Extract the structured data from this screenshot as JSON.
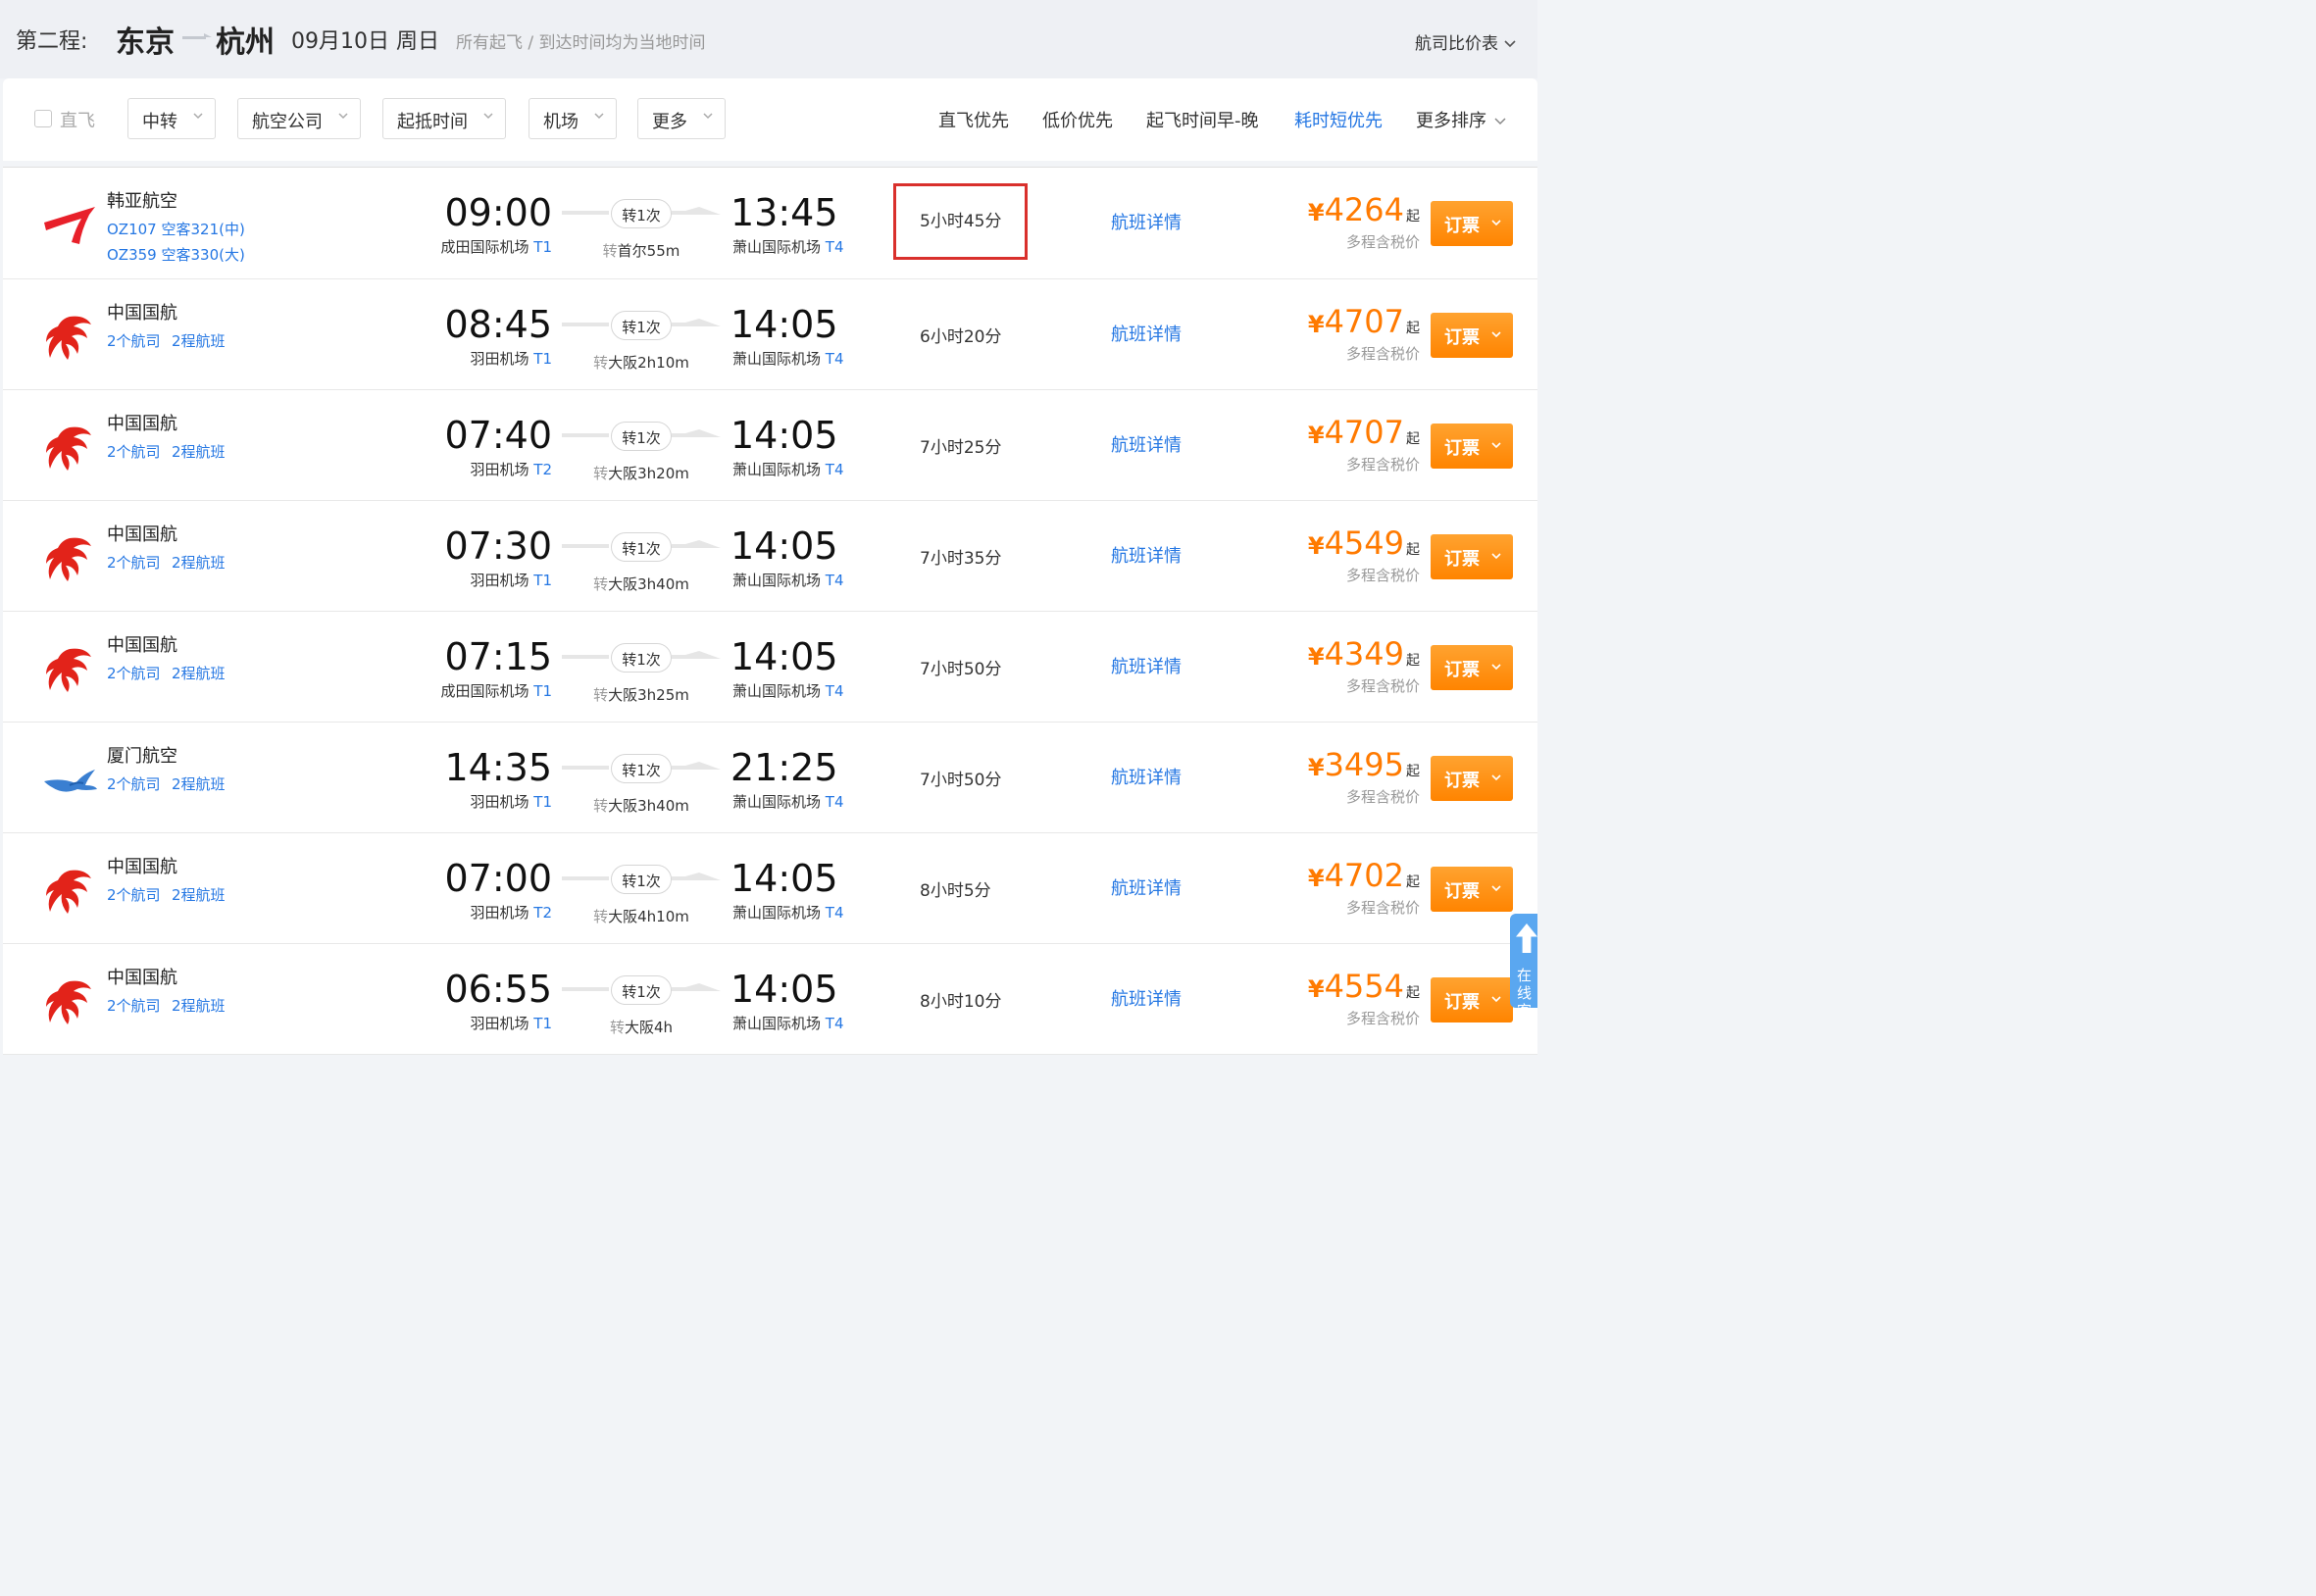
{
  "header": {
    "segment_label": "第二程:",
    "from_city": "东京",
    "to_city": "杭州",
    "date": "09月10日 周日",
    "note": "所有起飞 / 到达时间均为当地时间",
    "compare_link": "航司比价表"
  },
  "filters": {
    "direct_label": "直飞",
    "buttons": [
      "中转",
      "航空公司",
      "起抵时间",
      "机场",
      "更多"
    ]
  },
  "sort": {
    "options": [
      "直飞优先",
      "低价优先",
      "起飞时间早-晚",
      "耗时短优先",
      "更多排序"
    ],
    "active": "耗时短优先"
  },
  "flights": [
    {
      "airline": "韩亚航空",
      "logo": "asiana",
      "sub1": "OZ107 空客321(中)",
      "sub2": "OZ359 空客330(大)",
      "dep_time": "09:00",
      "dep_airport": "成田国际机场",
      "dep_terminal": "T1",
      "stop_badge": "转1次",
      "stop_prefix": "转",
      "stop_text": "首尔55m",
      "arr_time": "13:45",
      "arr_airport": "萧山国际机场",
      "arr_terminal": "T4",
      "duration": "5小时45分",
      "detail": "航班详情",
      "currency": "¥",
      "price": "4264",
      "price_suffix": "起",
      "tax_note": "多程含税价",
      "book": "订票",
      "highlighted": true
    },
    {
      "airline": "中国国航",
      "logo": "air-china",
      "sub1": "2个航司",
      "sub1b": "2程航班",
      "dep_time": "08:45",
      "dep_airport": "羽田机场",
      "dep_terminal": "T1",
      "stop_badge": "转1次",
      "stop_prefix": "转",
      "stop_text": "大阪2h10m",
      "arr_time": "14:05",
      "arr_airport": "萧山国际机场",
      "arr_terminal": "T4",
      "duration": "6小时20分",
      "detail": "航班详情",
      "currency": "¥",
      "price": "4707",
      "price_suffix": "起",
      "tax_note": "多程含税价",
      "book": "订票"
    },
    {
      "airline": "中国国航",
      "logo": "air-china",
      "sub1": "2个航司",
      "sub1b": "2程航班",
      "dep_time": "07:40",
      "dep_airport": "羽田机场",
      "dep_terminal": "T2",
      "stop_badge": "转1次",
      "stop_prefix": "转",
      "stop_text": "大阪3h20m",
      "arr_time": "14:05",
      "arr_airport": "萧山国际机场",
      "arr_terminal": "T4",
      "duration": "7小时25分",
      "detail": "航班详情",
      "currency": "¥",
      "price": "4707",
      "price_suffix": "起",
      "tax_note": "多程含税价",
      "book": "订票"
    },
    {
      "airline": "中国国航",
      "logo": "air-china",
      "sub1": "2个航司",
      "sub1b": "2程航班",
      "dep_time": "07:30",
      "dep_airport": "羽田机场",
      "dep_terminal": "T1",
      "stop_badge": "转1次",
      "stop_prefix": "转",
      "stop_text": "大阪3h40m",
      "arr_time": "14:05",
      "arr_airport": "萧山国际机场",
      "arr_terminal": "T4",
      "duration": "7小时35分",
      "detail": "航班详情",
      "currency": "¥",
      "price": "4549",
      "price_suffix": "起",
      "tax_note": "多程含税价",
      "book": "订票"
    },
    {
      "airline": "中国国航",
      "logo": "air-china",
      "sub1": "2个航司",
      "sub1b": "2程航班",
      "dep_time": "07:15",
      "dep_airport": "成田国际机场",
      "dep_terminal": "T1",
      "stop_badge": "转1次",
      "stop_prefix": "转",
      "stop_text": "大阪3h25m",
      "arr_time": "14:05",
      "arr_airport": "萧山国际机场",
      "arr_terminal": "T4",
      "duration": "7小时50分",
      "detail": "航班详情",
      "currency": "¥",
      "price": "4349",
      "price_suffix": "起",
      "tax_note": "多程含税价",
      "book": "订票"
    },
    {
      "airline": "厦门航空",
      "logo": "xiamen-air",
      "sub1": "2个航司",
      "sub1b": "2程航班",
      "dep_time": "14:35",
      "dep_airport": "羽田机场",
      "dep_terminal": "T1",
      "stop_badge": "转1次",
      "stop_prefix": "转",
      "stop_text": "大阪3h40m",
      "arr_time": "21:25",
      "arr_airport": "萧山国际机场",
      "arr_terminal": "T4",
      "duration": "7小时50分",
      "detail": "航班详情",
      "currency": "¥",
      "price": "3495",
      "price_suffix": "起",
      "tax_note": "多程含税价",
      "book": "订票"
    },
    {
      "airline": "中国国航",
      "logo": "air-china",
      "sub1": "2个航司",
      "sub1b": "2程航班",
      "dep_time": "07:00",
      "dep_airport": "羽田机场",
      "dep_terminal": "T2",
      "stop_badge": "转1次",
      "stop_prefix": "转",
      "stop_text": "大阪4h10m",
      "arr_time": "14:05",
      "arr_airport": "萧山国际机场",
      "arr_terminal": "T4",
      "duration": "8小时5分",
      "detail": "航班详情",
      "currency": "¥",
      "price": "4702",
      "price_suffix": "起",
      "tax_note": "多程含税价",
      "book": "订票"
    },
    {
      "airline": "中国国航",
      "logo": "air-china",
      "sub1": "2个航司",
      "sub1b": "2程航班",
      "dep_time": "06:55",
      "dep_airport": "羽田机场",
      "dep_terminal": "T1",
      "stop_badge": "转1次",
      "stop_prefix": "转",
      "stop_text": "大阪4h",
      "arr_time": "14:05",
      "arr_airport": "萧山国际机场",
      "arr_terminal": "T4",
      "duration": "8小时10分",
      "detail": "航班详情",
      "currency": "¥",
      "price": "4554",
      "price_suffix": "起",
      "tax_note": "多程含税价",
      "book": "订票"
    }
  ],
  "side_float": {
    "label": "在线客服"
  },
  "colors": {
    "accent": "#2577e3",
    "price": "#ff7a00",
    "book_button": "#ff8c00",
    "highlight_border": "#d9302c"
  }
}
